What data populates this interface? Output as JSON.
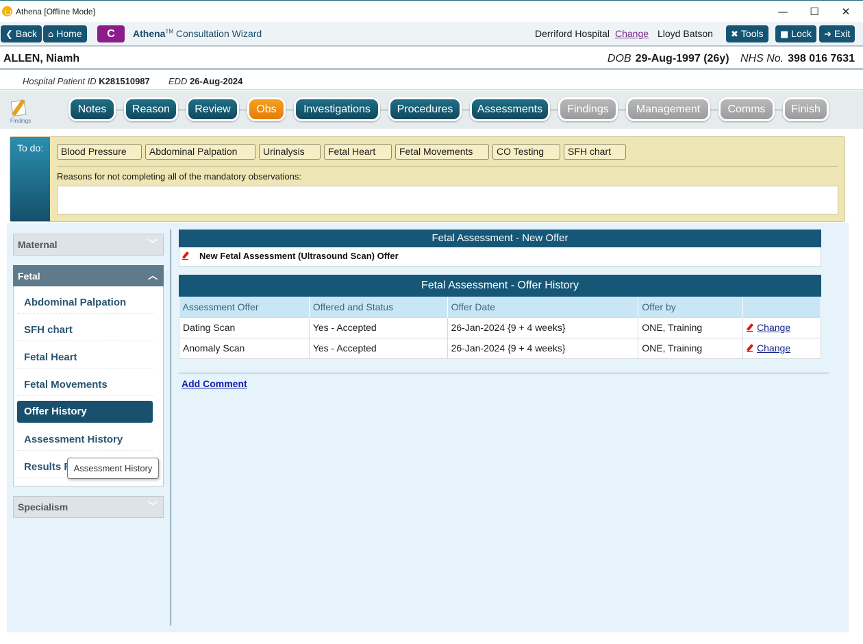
{
  "window": {
    "title": "Athena [Offline Mode]",
    "controls": {
      "minimize": "—",
      "maximize": "☐",
      "close": "✕"
    }
  },
  "toolbar": {
    "back_label": "Back",
    "home_label": "Home",
    "c_label": "C",
    "brand_name": "Athena",
    "brand_tm": "TM",
    "brand_suffix": "Consultation Wizard",
    "hospital": "Derriford Hospital",
    "hospital_change": "Change",
    "user": "Lloyd Batson",
    "tools_label": "Tools",
    "lock_label": "Lock",
    "exit_label": "Exit",
    "accent_color": "#155472"
  },
  "patient": {
    "name": "ALLEN, Niamh",
    "dob_label": "DOB",
    "dob": "29-Aug-1997 (26y)",
    "nhs_label": "NHS No.",
    "nhs": "398 016 7631",
    "hospital_id_label": "Hospital Patient ID",
    "hospital_id": "K281510987",
    "edd_label": "EDD",
    "edd": "26-Aug-2024"
  },
  "findings_icon_label": "Findings",
  "steps": [
    {
      "label": "Notes",
      "state": "done"
    },
    {
      "label": "Reason",
      "state": "done"
    },
    {
      "label": "Review",
      "state": "done"
    },
    {
      "label": "Obs",
      "state": "current"
    },
    {
      "label": "Investigations",
      "state": "done"
    },
    {
      "label": "Procedures",
      "state": "done"
    },
    {
      "label": "Assessments",
      "state": "done"
    },
    {
      "label": "Findings",
      "state": "todo"
    },
    {
      "label": "Management",
      "state": "todo"
    },
    {
      "label": "Comms",
      "state": "todo"
    },
    {
      "label": "Finish",
      "state": "todo"
    }
  ],
  "todo": {
    "label": "To do:",
    "items": [
      "Blood Pressure",
      "Abdominal Palpation",
      "Urinalysis",
      "Fetal Heart",
      "Fetal Movements",
      "CO Testing",
      "SFH chart"
    ],
    "reason_label": "Reasons for not completing all of the mandatory observations:",
    "reason_value": ""
  },
  "sidebar": {
    "maternal": "Maternal",
    "fetal": "Fetal",
    "specialism": "Specialism",
    "fetal_items": [
      "Abdominal Palpation",
      "SFH chart",
      "Fetal Heart",
      "Fetal Movements",
      "Offer History",
      "Assessment History",
      "Results Re"
    ],
    "active_item": "Offer History",
    "tooltip": "Assessment History"
  },
  "main": {
    "new_offer_title": "Fetal Assessment - New Offer",
    "new_offer_link": "New Fetal Assessment (Ultrasound Scan) Offer",
    "history_title": "Fetal Assessment - Offer History",
    "columns": [
      "Assessment Offer",
      "Offered and Status",
      "Offer Date",
      "Offer by",
      ""
    ],
    "rows": [
      {
        "offer": "Dating Scan",
        "status": "Yes - Accepted",
        "date": "26-Jan-2024 {9 + 4 weeks}",
        "by": "ONE, Training",
        "action": "Change"
      },
      {
        "offer": "Anomaly Scan",
        "status": "Yes - Accepted",
        "date": "26-Jan-2024 {9 + 4 weeks}",
        "by": "ONE, Training",
        "action": "Change"
      }
    ],
    "add_comment": "Add Comment"
  }
}
